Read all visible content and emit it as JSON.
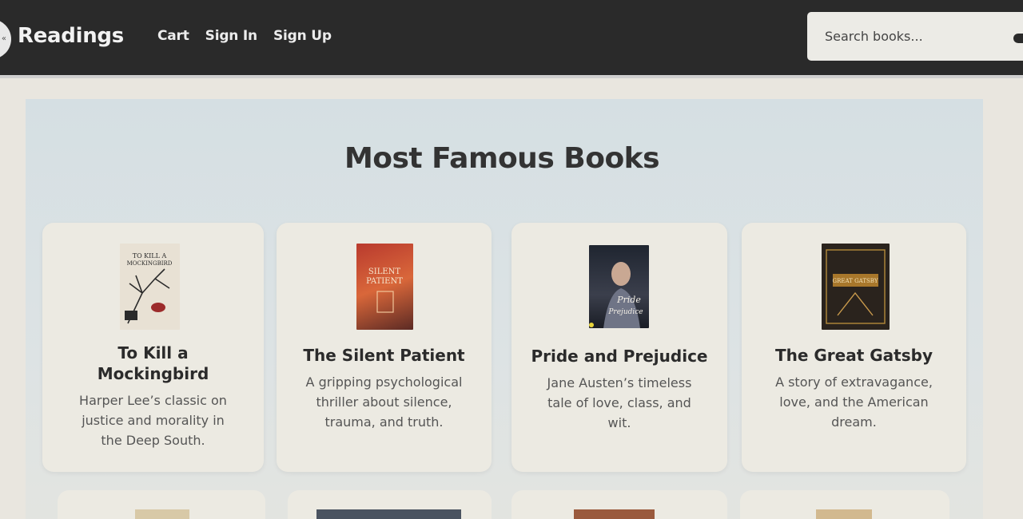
{
  "header": {
    "logo_glyph": "«",
    "brand": "Readings",
    "nav": [
      "Cart",
      "Sign In",
      "Sign Up"
    ],
    "search_placeholder": "Search books..."
  },
  "main": {
    "title": "Most Famous Books",
    "books": [
      {
        "title_line1": "To Kill a",
        "title_line2": "Mockingbird",
        "cover_text": "TO KILL A MOCKINGBIRD",
        "desc": [
          "Harper Lee’s classic on",
          "justice and morality in",
          "the Deep South."
        ]
      },
      {
        "title_line1": "The Silent Patient",
        "cover_text": "SILENT PATIENT",
        "desc": [
          "A gripping psychological",
          "thriller about silence,",
          "trauma, and truth."
        ]
      },
      {
        "title_line1": "Pride and Prejudice",
        "cover_text": "Pride Prejudice",
        "desc": [
          "Jane Austen’s timeless",
          "tale of love, class, and",
          "wit."
        ]
      },
      {
        "title_line1": "The Great Gatsby",
        "cover_text": "GREAT GATSBY",
        "desc": [
          "A story of extravagance,",
          "love, and the American",
          "dream."
        ]
      }
    ]
  }
}
